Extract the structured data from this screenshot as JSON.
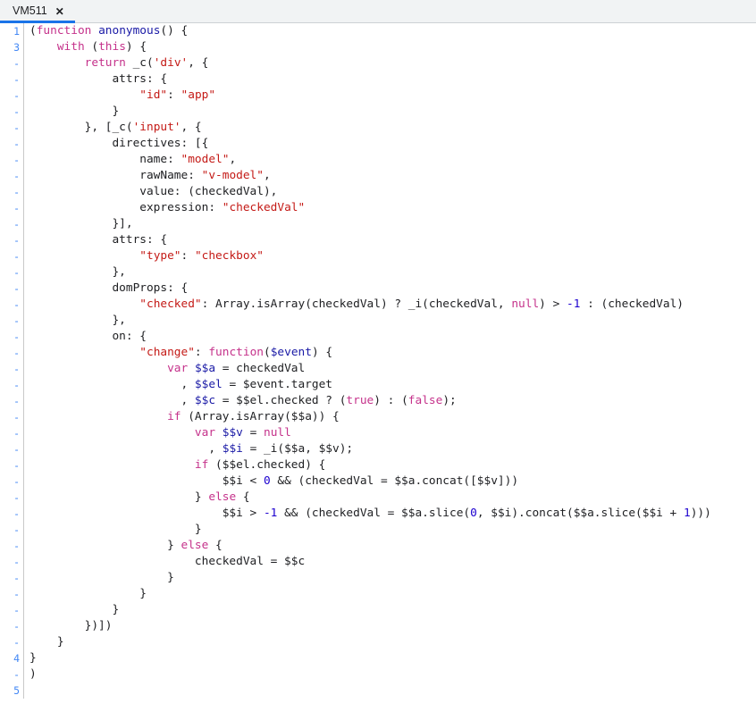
{
  "window": {
    "title": "VM511",
    "background_color": "#ffffff"
  },
  "tabbar": {
    "background_color": "#f1f3f4",
    "active_indicator_color": "#1a73e8",
    "tabs": [
      {
        "label": "VM511",
        "close_label": "✕",
        "active": true
      }
    ]
  },
  "theme": {
    "keyword_color": "#c5328b",
    "string_color": "#c41a16",
    "number_color": "#1c00cf",
    "definition_color": "#1a1aa6",
    "plain_color": "#202124",
    "gutter_color": "#4287f5",
    "gutter_border_color": "#c8c8c8"
  },
  "editor": {
    "language": "javascript",
    "lines": [
      {
        "num": "1",
        "tokens": [
          {
            "t": "(",
            "c": "plain"
          },
          {
            "t": "function",
            "c": "kw"
          },
          {
            "t": " ",
            "c": "plain"
          },
          {
            "t": "anonymous",
            "c": "def"
          },
          {
            "t": "() {",
            "c": "plain"
          }
        ]
      },
      {
        "num": "3",
        "tokens": [
          {
            "t": "    ",
            "c": "plain"
          },
          {
            "t": "with",
            "c": "kw"
          },
          {
            "t": " (",
            "c": "plain"
          },
          {
            "t": "this",
            "c": "kw"
          },
          {
            "t": ") {",
            "c": "plain"
          }
        ]
      },
      {
        "num": "-",
        "tokens": [
          {
            "t": "        ",
            "c": "plain"
          },
          {
            "t": "return",
            "c": "kw"
          },
          {
            "t": " _c(",
            "c": "plain"
          },
          {
            "t": "'div'",
            "c": "str"
          },
          {
            "t": ", {",
            "c": "plain"
          }
        ]
      },
      {
        "num": "-",
        "tokens": [
          {
            "t": "            attrs: {",
            "c": "plain"
          }
        ]
      },
      {
        "num": "-",
        "tokens": [
          {
            "t": "                ",
            "c": "plain"
          },
          {
            "t": "\"id\"",
            "c": "str"
          },
          {
            "t": ": ",
            "c": "plain"
          },
          {
            "t": "\"app\"",
            "c": "str"
          }
        ]
      },
      {
        "num": "-",
        "tokens": [
          {
            "t": "            }",
            "c": "plain"
          }
        ]
      },
      {
        "num": "-",
        "tokens": [
          {
            "t": "        }, [_c(",
            "c": "plain"
          },
          {
            "t": "'input'",
            "c": "str"
          },
          {
            "t": ", {",
            "c": "plain"
          }
        ]
      },
      {
        "num": "-",
        "tokens": [
          {
            "t": "            directives: [{",
            "c": "plain"
          }
        ]
      },
      {
        "num": "-",
        "tokens": [
          {
            "t": "                name: ",
            "c": "plain"
          },
          {
            "t": "\"model\"",
            "c": "str"
          },
          {
            "t": ",",
            "c": "plain"
          }
        ]
      },
      {
        "num": "-",
        "tokens": [
          {
            "t": "                rawName: ",
            "c": "plain"
          },
          {
            "t": "\"v-model\"",
            "c": "str"
          },
          {
            "t": ",",
            "c": "plain"
          }
        ]
      },
      {
        "num": "-",
        "tokens": [
          {
            "t": "                value: (checkedVal),",
            "c": "plain"
          }
        ]
      },
      {
        "num": "-",
        "tokens": [
          {
            "t": "                expression: ",
            "c": "plain"
          },
          {
            "t": "\"checkedVal\"",
            "c": "str"
          }
        ]
      },
      {
        "num": "-",
        "tokens": [
          {
            "t": "            }],",
            "c": "plain"
          }
        ]
      },
      {
        "num": "-",
        "tokens": [
          {
            "t": "            attrs: {",
            "c": "plain"
          }
        ]
      },
      {
        "num": "-",
        "tokens": [
          {
            "t": "                ",
            "c": "plain"
          },
          {
            "t": "\"type\"",
            "c": "str"
          },
          {
            "t": ": ",
            "c": "plain"
          },
          {
            "t": "\"checkbox\"",
            "c": "str"
          }
        ]
      },
      {
        "num": "-",
        "tokens": [
          {
            "t": "            },",
            "c": "plain"
          }
        ]
      },
      {
        "num": "-",
        "tokens": [
          {
            "t": "            domProps: {",
            "c": "plain"
          }
        ]
      },
      {
        "num": "-",
        "tokens": [
          {
            "t": "                ",
            "c": "plain"
          },
          {
            "t": "\"checked\"",
            "c": "str"
          },
          {
            "t": ": Array.isArray(checkedVal) ? _i(checkedVal, ",
            "c": "plain"
          },
          {
            "t": "null",
            "c": "kw"
          },
          {
            "t": ") > ",
            "c": "plain"
          },
          {
            "t": "-1",
            "c": "num"
          },
          {
            "t": " : (checkedVal)",
            "c": "plain"
          }
        ]
      },
      {
        "num": "-",
        "tokens": [
          {
            "t": "            },",
            "c": "plain"
          }
        ]
      },
      {
        "num": "-",
        "tokens": [
          {
            "t": "            on: {",
            "c": "plain"
          }
        ]
      },
      {
        "num": "-",
        "tokens": [
          {
            "t": "                ",
            "c": "plain"
          },
          {
            "t": "\"change\"",
            "c": "str"
          },
          {
            "t": ": ",
            "c": "plain"
          },
          {
            "t": "function",
            "c": "kw"
          },
          {
            "t": "(",
            "c": "plain"
          },
          {
            "t": "$event",
            "c": "def"
          },
          {
            "t": ") {",
            "c": "plain"
          }
        ]
      },
      {
        "num": "-",
        "tokens": [
          {
            "t": "                    ",
            "c": "plain"
          },
          {
            "t": "var",
            "c": "kw"
          },
          {
            "t": " ",
            "c": "plain"
          },
          {
            "t": "$$a",
            "c": "def"
          },
          {
            "t": " = checkedVal",
            "c": "plain"
          }
        ]
      },
      {
        "num": "-",
        "tokens": [
          {
            "t": "                      , ",
            "c": "plain"
          },
          {
            "t": "$$el",
            "c": "def"
          },
          {
            "t": " = $event.target",
            "c": "plain"
          }
        ]
      },
      {
        "num": "-",
        "tokens": [
          {
            "t": "                      , ",
            "c": "plain"
          },
          {
            "t": "$$c",
            "c": "def"
          },
          {
            "t": " = $$el.checked ? (",
            "c": "plain"
          },
          {
            "t": "true",
            "c": "kw"
          },
          {
            "t": ") : (",
            "c": "plain"
          },
          {
            "t": "false",
            "c": "kw"
          },
          {
            "t": ");",
            "c": "plain"
          }
        ]
      },
      {
        "num": "-",
        "tokens": [
          {
            "t": "                    ",
            "c": "plain"
          },
          {
            "t": "if",
            "c": "kw"
          },
          {
            "t": " (Array.isArray($$a)) {",
            "c": "plain"
          }
        ]
      },
      {
        "num": "-",
        "tokens": [
          {
            "t": "                        ",
            "c": "plain"
          },
          {
            "t": "var",
            "c": "kw"
          },
          {
            "t": " ",
            "c": "plain"
          },
          {
            "t": "$$v",
            "c": "def"
          },
          {
            "t": " = ",
            "c": "plain"
          },
          {
            "t": "null",
            "c": "kw"
          }
        ]
      },
      {
        "num": "-",
        "tokens": [
          {
            "t": "                          , ",
            "c": "plain"
          },
          {
            "t": "$$i",
            "c": "def"
          },
          {
            "t": " = _i($$a, $$v);",
            "c": "plain"
          }
        ]
      },
      {
        "num": "-",
        "tokens": [
          {
            "t": "                        ",
            "c": "plain"
          },
          {
            "t": "if",
            "c": "kw"
          },
          {
            "t": " ($$el.checked) {",
            "c": "plain"
          }
        ]
      },
      {
        "num": "-",
        "tokens": [
          {
            "t": "                            $$i < ",
            "c": "plain"
          },
          {
            "t": "0",
            "c": "num"
          },
          {
            "t": " && (checkedVal = $$a.concat([$$v]))",
            "c": "plain"
          }
        ]
      },
      {
        "num": "-",
        "tokens": [
          {
            "t": "                        } ",
            "c": "plain"
          },
          {
            "t": "else",
            "c": "kw"
          },
          {
            "t": " {",
            "c": "plain"
          }
        ]
      },
      {
        "num": "-",
        "tokens": [
          {
            "t": "                            $$i > ",
            "c": "plain"
          },
          {
            "t": "-1",
            "c": "num"
          },
          {
            "t": " && (checkedVal = $$a.slice(",
            "c": "plain"
          },
          {
            "t": "0",
            "c": "num"
          },
          {
            "t": ", $$i).concat($$a.slice($$i + ",
            "c": "plain"
          },
          {
            "t": "1",
            "c": "num"
          },
          {
            "t": ")))",
            "c": "plain"
          }
        ]
      },
      {
        "num": "-",
        "tokens": [
          {
            "t": "                        }",
            "c": "plain"
          }
        ]
      },
      {
        "num": "-",
        "tokens": [
          {
            "t": "                    } ",
            "c": "plain"
          },
          {
            "t": "else",
            "c": "kw"
          },
          {
            "t": " {",
            "c": "plain"
          }
        ]
      },
      {
        "num": "-",
        "tokens": [
          {
            "t": "                        checkedVal = $$c",
            "c": "plain"
          }
        ]
      },
      {
        "num": "-",
        "tokens": [
          {
            "t": "                    }",
            "c": "plain"
          }
        ]
      },
      {
        "num": "-",
        "tokens": [
          {
            "t": "                }",
            "c": "plain"
          }
        ]
      },
      {
        "num": "-",
        "tokens": [
          {
            "t": "            }",
            "c": "plain"
          }
        ]
      },
      {
        "num": "-",
        "tokens": [
          {
            "t": "        })])",
            "c": "plain"
          }
        ]
      },
      {
        "num": "-",
        "tokens": [
          {
            "t": "    }",
            "c": "plain"
          }
        ]
      },
      {
        "num": "4",
        "tokens": [
          {
            "t": "}",
            "c": "plain"
          }
        ]
      },
      {
        "num": "-",
        "tokens": [
          {
            "t": ")",
            "c": "plain"
          }
        ]
      },
      {
        "num": "5",
        "tokens": []
      }
    ]
  }
}
